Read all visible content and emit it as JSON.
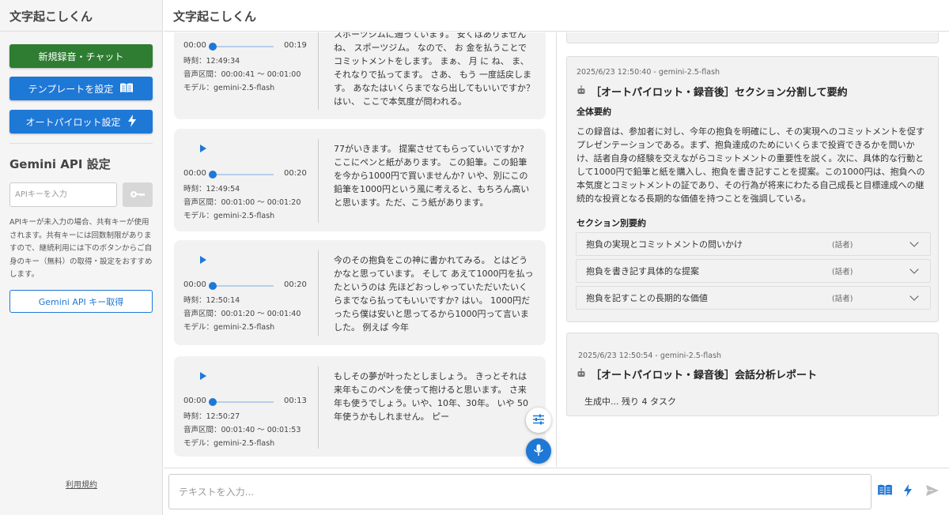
{
  "app": {
    "title": "文字起こしくん"
  },
  "sidebar": {
    "title": "文字起こしくん",
    "new_button": "新規録音・チャット",
    "template_button": "テンプレートを設定",
    "autopilot_button": "オートパイロット設定",
    "api_heading": "Gemini API 設定",
    "api_placeholder": "APIキーを入力",
    "api_note": "APIキーが未入力の場合、共有キーが使用されます。共有キーには回数制限がありますので、継続利用には下のボタンからご自身のキー（無料）の取得・設定をおすすめします。",
    "get_key_button": "Gemini API キー取得",
    "terms_link": "利用規約"
  },
  "main": {
    "title": "文字起こしくん"
  },
  "transcripts": [
    {
      "time_start": "00:00",
      "time_end": "00:19",
      "clock": "時刻：12:49:34",
      "range": "音声区間：00:00:41 〜 00:01:00",
      "model": "モデル：gemini-2.5-flash",
      "text": "スポーツジムに通っています。 安くはありませんね、 スポーツジム。 なので、 お 金を払うことでコミットメントをします。 まぁ、 月 に ね、 ま、 それなりで払ってます。 さあ、 もう 一度話戻します。 あなたはいくらまでなら出してもいいですか？はい、 ここで本気度が問われる。"
    },
    {
      "time_start": "00:00",
      "time_end": "00:20",
      "clock": "時刻：12:49:54",
      "range": "音声区間：00:01:00 〜 00:01:20",
      "model": "モデル：gemini-2.5-flash",
      "text": "77がいきます。 提案させてもらっていいですか? ここにペンと紙があります。 この鉛筆。この鉛筆を今から1000円で買いませんか? いや、別にこの鉛筆を1000円という風に考えると、もちろん高いと思います。ただ、こう紙があります。"
    },
    {
      "time_start": "00:00",
      "time_end": "00:20",
      "clock": "時刻：12:50:14",
      "range": "音声区間：00:01:20 〜 00:01:40",
      "model": "モデル：gemini-2.5-flash",
      "text": "今のその抱負をこの神に書かれてみる。 とはどうかなと思っています。 そして あえて1000円を払ったというのは 先ほどおっしゃっていただいたいくらまでなら払ってもいいですか? はい。 1000円だったら僕は安いと思ってるから1000円って言いました。 例えば 今年"
    },
    {
      "time_start": "00:00",
      "time_end": "00:13",
      "clock": "時刻：12:50:27",
      "range": "音声区間：00:01:40 〜 00:01:53",
      "model": "モデル：gemini-2.5-flash",
      "text": "もしその夢が叶ったとしましょう。 きっとそれは来年もこのペンを使って抱けると思います。 さ来年も使うでしょう。いや、10年、30年。 いや 50年使うかもしれません。 ピー"
    }
  ],
  "results": [
    {
      "timestamp": "2025/6/23 12:50:40 - gemini-2.5-flash",
      "title": "［オートパイロット・録音後］セクション分割して要約",
      "overall_heading": "全体要約",
      "overall_text": "この録音は、参加者に対し、今年の抱負を明確にし、その実現へのコミットメントを促すプレゼンテーションである。まず、抱負達成のためにいくらまで投資できるかを問いかけ、話者自身の経験を交えながらコミットメントの重要性を説く。次に、具体的な行動として1000円で鉛筆と紙を購入し、抱負を書き記すことを提案。この1000円は、抱負への本気度とコミットメントの証であり、その行為が将来にわたる自己成長と目標達成への継続的な投資となる長期的な価値を持つことを強調している。",
      "sections_heading": "セクション別要約",
      "sections": [
        {
          "label": "抱負の実現とコミットメントの問いかけ",
          "speaker": "(話者)"
        },
        {
          "label": "抱負を書き記す具体的な提案",
          "speaker": "(話者)"
        },
        {
          "label": "抱負を記すことの長期的な価値",
          "speaker": "(話者)"
        }
      ]
    },
    {
      "timestamp": "2025/6/23 12:50:54 - gemini-2.5-flash",
      "title": "［オートパイロット・録音後］会話分析レポート",
      "status": "生成中... 残り 4 タスク"
    }
  ],
  "input": {
    "placeholder": "テキストを入力..."
  },
  "colors": {
    "primary": "#1e78d6",
    "success": "#2e7d32"
  },
  "icons": [
    "book-icon",
    "bolt-icon",
    "key-icon",
    "tune-icon",
    "mic-icon",
    "send-icon",
    "play-icon",
    "chevron-down-icon",
    "robot-icon"
  ]
}
